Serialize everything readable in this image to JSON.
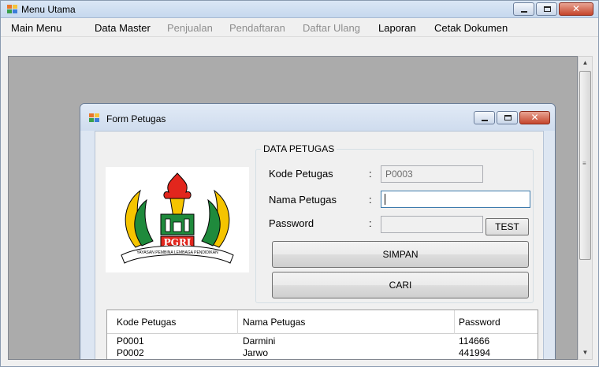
{
  "main_window": {
    "title": "Menu Utama"
  },
  "menu": {
    "items": [
      {
        "label": "Main Menu",
        "enabled": true
      },
      {
        "label": "Data Master",
        "enabled": true
      },
      {
        "label": "Penjualan",
        "enabled": false
      },
      {
        "label": "Pendaftaran",
        "enabled": false
      },
      {
        "label": "Daftar Ulang",
        "enabled": false
      },
      {
        "label": "Laporan",
        "enabled": true
      },
      {
        "label": "Cetak Dokumen",
        "enabled": true
      }
    ]
  },
  "form": {
    "title": "Form Petugas",
    "group_title": "DATA PETUGAS",
    "fields": {
      "kode": {
        "label": "Kode Petugas",
        "colon": ":",
        "value": "P0003"
      },
      "nama": {
        "label": "Nama Petugas",
        "colon": ":",
        "value": ""
      },
      "password": {
        "label": "Password",
        "colon": ":",
        "value": ""
      }
    },
    "test_label": "TEST",
    "simpan_label": "SIMPAN",
    "cari_label": "CARI"
  },
  "logo": {
    "emblem_text": "PGRI",
    "ribbon_text": "YAYASAN PEMBINA LEMBAGA PENDIDIKAN",
    "colors": {
      "gold": "#f5c400",
      "red": "#e2261d",
      "green": "#1f8a3c"
    }
  },
  "grid": {
    "headers": [
      "Kode Petugas",
      "Nama Petugas",
      "Password"
    ],
    "rows": [
      [
        "P0001",
        "Darmini",
        "114666"
      ],
      [
        "P0002",
        "Jarwo",
        "441994"
      ]
    ]
  },
  "colors": {
    "mdi_background": "#ababab",
    "title_bar": "#dbe7f5",
    "close_button": "#c5452c"
  }
}
